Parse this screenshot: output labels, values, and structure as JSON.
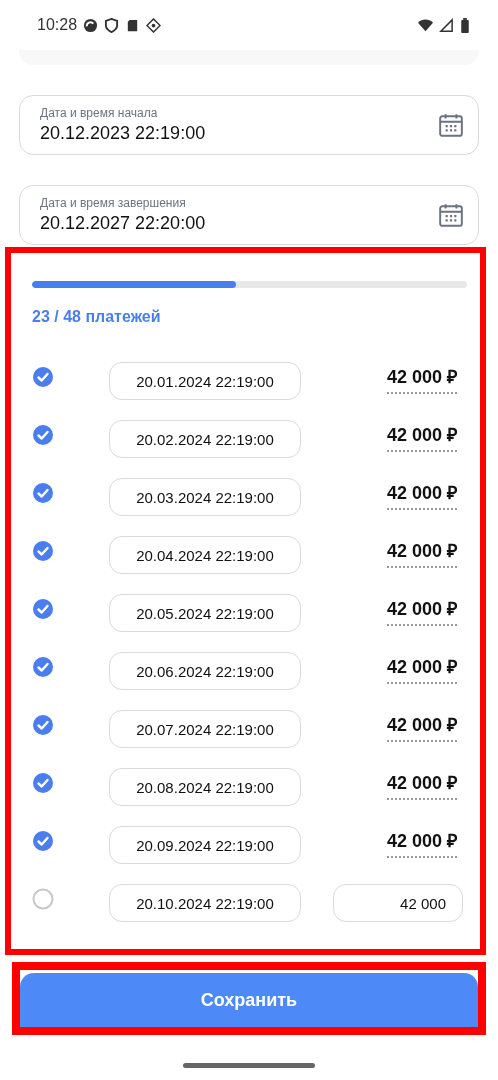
{
  "status_bar": {
    "time": "10:28"
  },
  "start_field": {
    "label": "Дата и время начала",
    "value": "20.12.2023 22:19:00"
  },
  "end_field": {
    "label": "Дата и время завершения",
    "value": "20.12.2027 22:20:00"
  },
  "progress": {
    "level": 0.47,
    "label": "23 / 48 платежей"
  },
  "payments": [
    {
      "checked": true,
      "date": "20.01.2024 22:19:00",
      "kind": "text",
      "amount": "42 000 ₽"
    },
    {
      "checked": true,
      "date": "20.02.2024 22:19:00",
      "kind": "text",
      "amount": "42 000 ₽"
    },
    {
      "checked": true,
      "date": "20.03.2024 22:19:00",
      "kind": "text",
      "amount": "42 000 ₽"
    },
    {
      "checked": true,
      "date": "20.04.2024 22:19:00",
      "kind": "text",
      "amount": "42 000 ₽"
    },
    {
      "checked": true,
      "date": "20.05.2024 22:19:00",
      "kind": "text",
      "amount": "42 000 ₽"
    },
    {
      "checked": true,
      "date": "20.06.2024 22:19:00",
      "kind": "text",
      "amount": "42 000 ₽"
    },
    {
      "checked": true,
      "date": "20.07.2024 22:19:00",
      "kind": "text",
      "amount": "42 000 ₽"
    },
    {
      "checked": true,
      "date": "20.08.2024 22:19:00",
      "kind": "text",
      "amount": "42 000 ₽"
    },
    {
      "checked": true,
      "date": "20.09.2024 22:19:00",
      "kind": "text",
      "amount": "42 000 ₽"
    },
    {
      "checked": false,
      "date": "20.10.2024 22:19:00",
      "kind": "input",
      "amount": "42 000"
    }
  ],
  "save_button": {
    "label": "Сохранить"
  }
}
